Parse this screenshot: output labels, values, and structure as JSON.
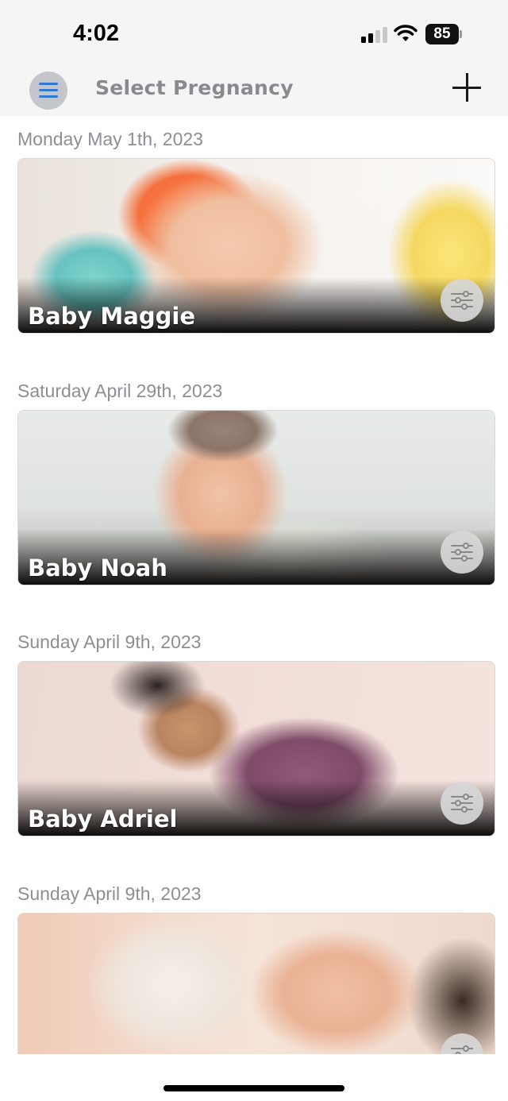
{
  "status_bar": {
    "time": "4:02",
    "battery_level": "85",
    "signal_icon": "cellular-signal-icon",
    "wifi_icon": "wifi-icon",
    "battery_icon": "battery-icon"
  },
  "nav": {
    "title": "Select Pregnancy",
    "menu_icon": "hamburger-menu-icon",
    "add_icon": "plus-icon",
    "accent_color": "#2f7ad9"
  },
  "pregnancies": [
    {
      "date": "Monday May 1th, 2023",
      "name": "Baby Maggie"
    },
    {
      "date": "Saturday April 29th, 2023",
      "name": "Baby Noah"
    },
    {
      "date": "Sunday April 9th, 2023",
      "name": "Baby Adriel"
    },
    {
      "date": "Sunday April 9th, 2023",
      "name": ""
    }
  ],
  "card_settings_icon": "sliders-settings-icon"
}
